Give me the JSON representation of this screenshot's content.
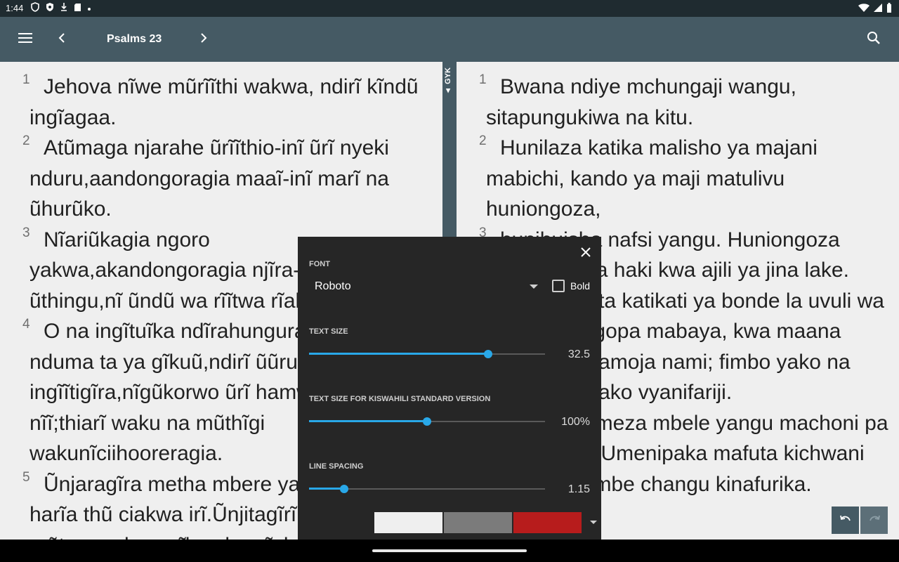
{
  "status_bar": {
    "time": "1:44",
    "icons": [
      "vpn-shield-icon",
      "shield-icon",
      "download-icon",
      "sd-card-icon",
      "dot-icon"
    ],
    "right_icons": [
      "wifi-icon",
      "signal-icon",
      "battery-icon"
    ]
  },
  "app_bar": {
    "title": "Psalms 23",
    "icons": [
      "menu-icon",
      "chevron-left-icon",
      "chevron-right-icon",
      "search-icon"
    ],
    "color": "#455a64"
  },
  "divider": {
    "label": "GYK",
    "arrow": "▲"
  },
  "left_pane": {
    "verses": [
      {
        "num": "1",
        "text": "Jehova nĩwe mũrĩĩthi wakwa, ndirĩ kĩndũ ingĩagaa."
      },
      {
        "num": "2",
        "text": "Atũmaga njarahe ũrĩĩthio-inĩ ũrĩ nyeki nduru,aandongoragia maaĩ-inĩ marĩ na ũhurũko."
      },
      {
        "num": "3",
        "text": "Nĩariũkagia ngoro yakwa,akandongoragia njĩra-inĩ cia ũthingu,nĩ ũndũ wa rĩĩtwa rĩake."
      },
      {
        "num": "4",
        "text": "O na ingĩtuĩka ndĩrahungura mũkuru ũrĩ nduma ta ya gĩkuũ,ndirĩ ũũru ingĩĩtigĩra,nĩgũkorwo ũrĩ hamwe na nĩĩ;thiarĩ waku na mũthĩgi wakunĩciihooreragia."
      },
      {
        "num": "5",
        "text": "Ũnjaragĩra metha mbere ya thũ ciakwa harĩa thũ ciakwa irĩ.Ũnjitagĩrĩria maguta mũtwe wakwa,gĩkombe gĩakwa nĩkĩiyũrĩte."
      }
    ]
  },
  "right_pane": {
    "verses": [
      {
        "num": "1",
        "text": "Bwana  ndiye mchungaji wangu, sitapungukiwa na kitu."
      },
      {
        "num": "2",
        "text": "Hunilaza katika malisho ya majani mabichi, kando ya maji matulivu huniongoza,"
      },
      {
        "num": "3",
        "text": "hunihuisha nafsi yangu. Huniongoza katika njia za haki kwa ajili ya jina lake."
      },
      {
        "num": "4",
        "text": "Hata nikipita katikati ya bonde la uvuli wa mauti, sitaogopa mabaya, kwa maana wewe upo pamoja nami; fimbo yako na mkongojo wako vyanifariji."
      },
      {
        "num": "5",
        "text": "Waandaa meza mbele yangu machoni pa adui zangu. Umenipaka mafuta kichwani pangu, kikombe changu kinafurika."
      }
    ]
  },
  "settings": {
    "close_icon": "close-icon",
    "font_label": "FONT",
    "font_value": "Roboto",
    "bold_label": "Bold",
    "bold_checked": false,
    "text_size_label": "TEXT SIZE",
    "text_size_value": "32.5",
    "text_size_fraction": 0.76,
    "ksv_label": "TEXT SIZE FOR KISWAHILI STANDARD VERSION",
    "ksv_value": "100%",
    "ksv_fraction": 0.5,
    "line_spacing_label": "LINE SPACING",
    "line_spacing_value": "1.15",
    "line_spacing_fraction": 0.15,
    "swatches": [
      "#262626",
      "#efefef",
      "#7b7b7b",
      "#b71c1c"
    ],
    "accent": "#29a8e8"
  },
  "undo_redo": {
    "icons": [
      "undo-icon",
      "redo-icon"
    ]
  }
}
